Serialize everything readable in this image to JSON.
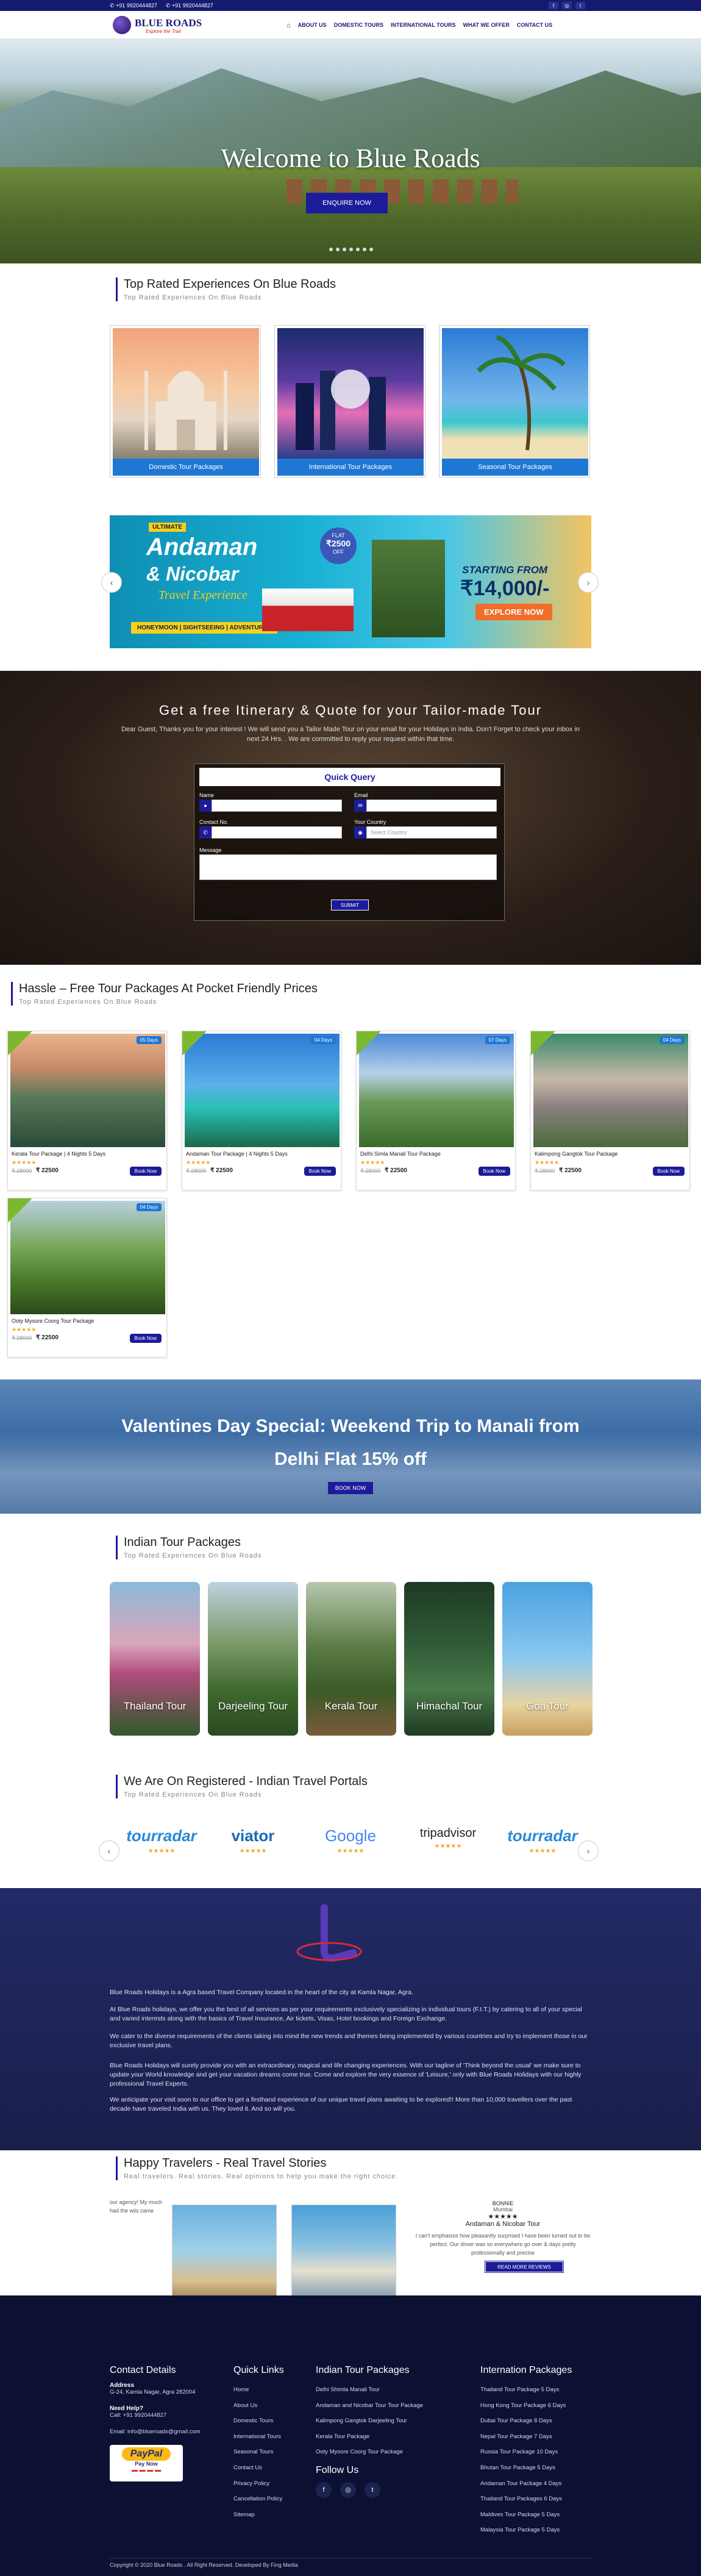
{
  "topbar": {
    "phone1": "+91 9920444827",
    "phone2": "+91 9920444827"
  },
  "brand": {
    "name": "BLUE ROADS",
    "tagline": "Explore the Trail"
  },
  "nav": {
    "items": [
      "ABOUT US",
      "DOMESTIC TOURS",
      "INTERNATIONAL TOURS",
      "WHAT WE OFFER",
      "CONTACT US"
    ]
  },
  "hero": {
    "title": "Welcome to Blue Roads",
    "button": "ENQUIRE NOW"
  },
  "top_rated": {
    "title": "Top Rated Experiences On Blue Roads",
    "subtitle": "Top Rated Experiences On Blue Roads",
    "cards": [
      "Domestic Tour Packages",
      "International Tour Packages",
      "Seasonal Tour Packages"
    ]
  },
  "promo": {
    "badge": "ULTIMATE",
    "title1": "Andaman",
    "amp": "& Nicobar",
    "subtitle": "Travel Experience",
    "flat_label": "FLAT",
    "flat_amount": "₹2500",
    "off": "OFF",
    "tags": "HONEYMOON | SIGHTSEEING | ADVENTURES",
    "starting": "STARTING FROM",
    "price": "₹14,000/-",
    "cta": "EXPLORE NOW"
  },
  "quote": {
    "title": "Get a free Itinerary & Quote for your Tailor-made Tour",
    "text": "Dear Guest, Thanks you for your interest ! We will send you a Tailor Made Tour on your email for your Holidays in India. Don't Forget to check your inbox in next 24 Hrs. . We are committed to reply your request within that time.",
    "form_title": "Quick Query",
    "name_label": "Name",
    "email_label": "Email",
    "contact_label": "Contact No.",
    "country_label": "Your Country",
    "country_placeholder": "Select Country",
    "message_label": "Message",
    "submit": "SUBMIT"
  },
  "packages": {
    "title": "Hassle – Free Tour Packages At Pocket Friendly Prices",
    "subtitle": "Top Rated Experiences On Blue Roads",
    "items": [
      {
        "name": "Kerala Tour Package | 4 Nights 5 Days",
        "days": "05 Days",
        "old": "₹ 28000",
        "new": "₹ 22500",
        "book": "Book Now"
      },
      {
        "name": "Andaman Tour Package | 4 Nights 5 Days",
        "days": "04 Days",
        "old": "₹ 28000",
        "new": "₹ 22500",
        "book": "Book Now"
      },
      {
        "name": "Delhi Simla Manali Tour Package",
        "days": "07 Days",
        "old": "₹ 28000",
        "new": "₹ 22500",
        "book": "Book Now"
      },
      {
        "name": "Kalimpong Gangtok Tour Package",
        "days": "04 Days",
        "old": "₹ 28000",
        "new": "₹ 22500",
        "book": "Book Now"
      },
      {
        "name": "Ooty Mysore Coorg Tour Package",
        "days": "04 Days",
        "old": "₹ 28000",
        "new": "₹ 22500",
        "book": "Book Now"
      }
    ]
  },
  "valentine": {
    "title": "Valentines Day Special: Weekend Trip to Manali from Delhi Flat 15% off",
    "button": "BOOK NOW"
  },
  "indian": {
    "title": "Indian Tour Packages",
    "subtitle": "Top Rated Experiences On Blue Roads",
    "items": [
      "Thailand Tour",
      "Darjeeling Tour",
      "Kerala Tour",
      "Himachal Tour",
      "Goa Tour"
    ]
  },
  "portals": {
    "title": "We Are On Registered - Indian Travel Portals",
    "subtitle": "Top Rated Experiences On Blue Roads",
    "items": [
      "tourradar",
      "viator",
      "Google",
      "tripadvisor",
      "tourradar"
    ],
    "stars": "★★★★★"
  },
  "about": {
    "p1": "Blue Roads Holidays is a Agra based Travel Company located in the heart of the city at Kamla Nagar, Agra.",
    "p2": "At Blue Roads holidays, we offer you the best of all services as per your requirements exclusively specializing in individual tours (F.I.T.) by catering to all of your special and varied interests along with the basics of Travel Insurance, Air tickets, Visas, Hotel bookings and Foreign Exchange.",
    "p3": "We cater to the diverse requirements of the clients taking into mind the new trends and themes being implemented by various countries and try to implement those in our exclusive travel plans.",
    "p4": "Blue Roads Holidays will surely provide you with an extraordinary, magical and life changing experiences. With our tagline of 'Think beyond the usual' we make sure to update your World knowledge and get your vacation dreams come true. Come and explore the very essence of 'Leisure,' only with Blue Roads Holidays with our highly professional Travel Experts.",
    "p5": "We anticipate your visit soon to our office to get a firsthand experience of our unique travel plans awaiting to be explored!! More than 10,000 travellers over the past decade have traveled India with us. They loved it. And so will you."
  },
  "stories": {
    "title": "Happy Travelers - Real Travel Stories",
    "subtitle": "Real travelers. Real stories. Real opinions to help you make the right choice.",
    "left_text": "our agency! My much had the wiis came",
    "reviewer": "BONNIE",
    "place": "Mumbai",
    "stars": "★★★★★",
    "trip": "Andaman & Nicobar Tour",
    "review": "I can't emphasize how pleasantly surprised I have been turned out to be perfect. Our driver was so everywhere go over & days pretty professionally and precise",
    "button": "READ MORE REVIEWS"
  },
  "footer": {
    "contact_title": "Contact Details",
    "address_label": "Address",
    "address": "G-24, Kamla Nagar, Agra 282004",
    "help_label": "Need Help?",
    "phone": "Call: +91 9920444827",
    "email": "Email: info@blueroads@gmail.com",
    "paypal1": "PayPal",
    "paypal2": "Pay Now",
    "quick_title": "Quick Links",
    "quick": [
      "Home",
      "About Us",
      "Domestic Tours",
      "International Tours",
      "Seasonal Tours",
      "Contact Us",
      "Privacy Policy",
      "Cancellation Policy",
      "Sitemap"
    ],
    "indian_title": "Indian Tour Packages",
    "indian": [
      "Delhi Shimla Manali Tour",
      "Andaman and Nicobar Tour Tour Package",
      "Kalimpong Gangtok Darjeeling Tour",
      "Kerala Tour Package",
      "Ooty Mysore Coorg Tour Package"
    ],
    "follow": "Follow Us",
    "intl_title": "Internation Packages",
    "intl": [
      "Thailand Tour Package 5 Days",
      "Hong Kong Tour Package 6 Days",
      "Dubai Tour Package 8 Days",
      "Nepal Tour Package 7 Days",
      "Russia Tour Package 10 Days",
      "Bhutan Tour Package 5 Days",
      "Andaman Tour Package 4 Days",
      "Thailand Tour Packages 6 Days",
      "Maldives Tour Package 5 Days",
      "Malaysia Tour Package 5 Days"
    ],
    "copyright": "Copyright © 2020 Blue Roads . All Right Reserved. Developed By Fing Media"
  }
}
